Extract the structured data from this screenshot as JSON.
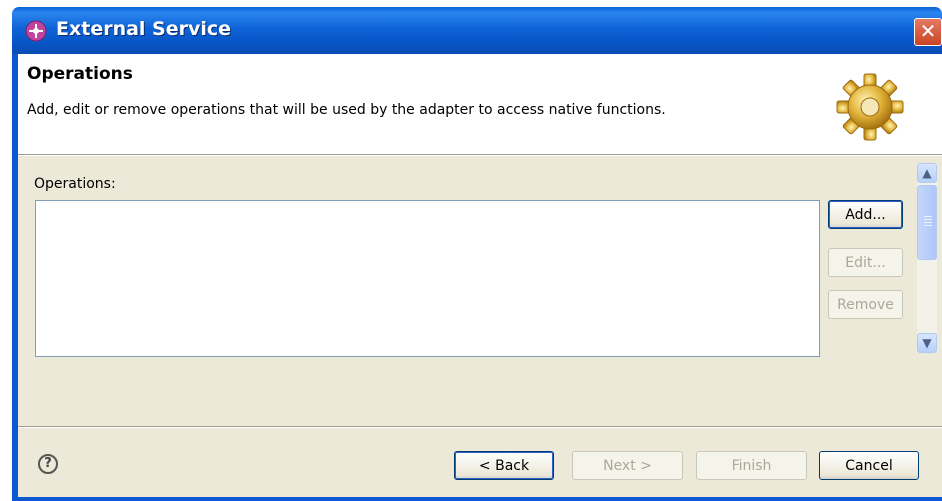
{
  "window": {
    "title": "External Service",
    "close_symbol": "✕"
  },
  "header": {
    "title": "Operations",
    "description": "Add, edit or remove operations that will be used by the adapter to access native functions."
  },
  "operations": {
    "label": "Operations:",
    "items": [],
    "buttons": {
      "add": "Add...",
      "edit": "Edit...",
      "remove": "Remove"
    }
  },
  "footer": {
    "help_symbol": "?",
    "back": "< Back",
    "next": "Next >",
    "finish": "Finish",
    "cancel": "Cancel"
  },
  "icons": {
    "window": "service-icon",
    "banner": "gear-icon",
    "help": "help-icon"
  },
  "colors": {
    "titlebar": "#0a5fd6",
    "dialog_bg": "#ece9d8",
    "close_button": "#d65a3d"
  }
}
